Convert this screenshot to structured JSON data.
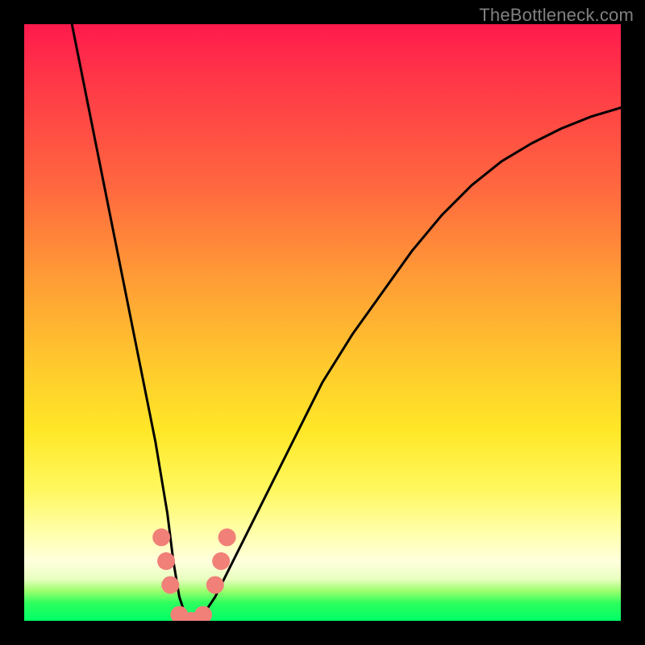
{
  "watermark": "TheBottleneck.com",
  "chart_data": {
    "type": "line",
    "title": "",
    "xlabel": "",
    "ylabel": "",
    "xlim": [
      0,
      100
    ],
    "ylim": [
      0,
      100
    ],
    "series": [
      {
        "name": "bottleneck-curve",
        "x": [
          8,
          10,
          12,
          14,
          16,
          18,
          20,
          22,
          24,
          25,
          26,
          27,
          28,
          29,
          30,
          32,
          35,
          40,
          45,
          50,
          55,
          60,
          65,
          70,
          75,
          80,
          85,
          90,
          95,
          100
        ],
        "values": [
          100,
          90,
          80,
          70,
          60,
          50,
          40,
          30,
          18,
          10,
          4,
          1,
          0,
          0.5,
          1,
          4,
          10,
          20,
          30,
          40,
          48,
          55,
          62,
          68,
          73,
          77,
          80,
          82.5,
          84.5,
          86
        ]
      }
    ],
    "markers": [
      {
        "name": "left-cluster-top",
        "x": 23.0,
        "y": 14,
        "color": "#f08078"
      },
      {
        "name": "left-cluster-mid",
        "x": 23.8,
        "y": 10,
        "color": "#f08078"
      },
      {
        "name": "left-cluster-low",
        "x": 24.5,
        "y": 6,
        "color": "#f08078"
      },
      {
        "name": "dip-left",
        "x": 26.0,
        "y": 1,
        "color": "#f08078"
      },
      {
        "name": "dip-mid",
        "x": 28.0,
        "y": 0,
        "color": "#f08078"
      },
      {
        "name": "dip-right",
        "x": 30.0,
        "y": 1,
        "color": "#f08078"
      },
      {
        "name": "right-cluster-low",
        "x": 32.0,
        "y": 6,
        "color": "#f08078"
      },
      {
        "name": "right-cluster-mid",
        "x": 33.0,
        "y": 10,
        "color": "#f08078"
      },
      {
        "name": "right-cluster-top",
        "x": 34.0,
        "y": 14,
        "color": "#f08078"
      }
    ],
    "gradient_bands": [
      {
        "color": "#ff1a4d",
        "from_y": 100,
        "to_y": 86
      },
      {
        "color": "#ff9a36",
        "from_y": 86,
        "to_y": 55
      },
      {
        "color": "#ffe727",
        "from_y": 55,
        "to_y": 20
      },
      {
        "color": "#ffffc0",
        "from_y": 20,
        "to_y": 6
      },
      {
        "color": "#00ff66",
        "from_y": 6,
        "to_y": 0
      }
    ]
  }
}
